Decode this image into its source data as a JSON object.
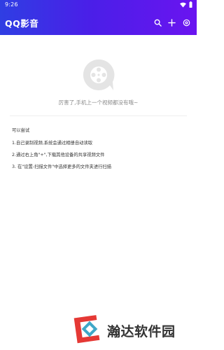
{
  "status_bar": {
    "time": "9:26"
  },
  "app": {
    "title": "QQ影音"
  },
  "toolbar": {
    "icons": [
      "search-icon",
      "plus-icon",
      "settings-icon"
    ]
  },
  "empty_state": {
    "icon": "film-reel-icon",
    "message": "厉害了,手机上一个视频都没有哦~"
  },
  "tips": {
    "heading": "可以尝试",
    "items": [
      "1.自己录制视频,系统会通过相册自动读取",
      "2.通过右上角\"+\",下载其他设备的共享视频文件",
      "3. 在\"设置-扫描文件\"中选择更多的文件夹进行扫描"
    ]
  },
  "watermark": {
    "text": "瀚达软件园"
  },
  "colors": {
    "header_start": "#2f3ee3",
    "header_end": "#6a14f0",
    "watermark_red": "#e53935"
  }
}
